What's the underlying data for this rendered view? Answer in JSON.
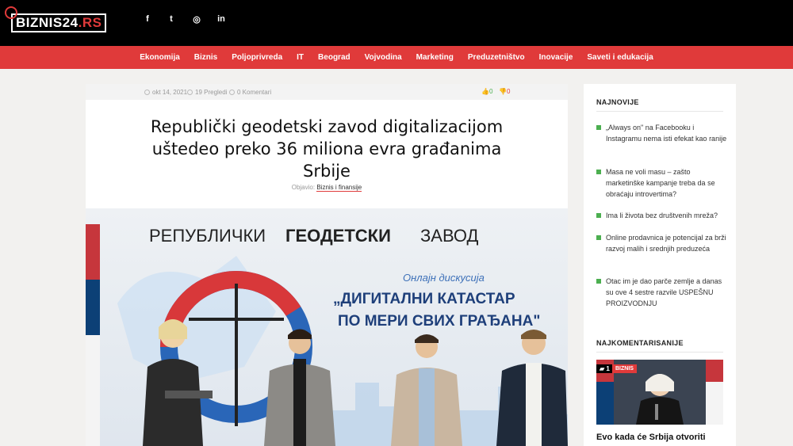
{
  "logo": {
    "main": "BIZNIS24",
    "accent": ".RS"
  },
  "social": [
    {
      "icon": "facebook-icon",
      "glyph": "f"
    },
    {
      "icon": "twitter-icon",
      "glyph": "t"
    },
    {
      "icon": "instagram-icon",
      "glyph": "◎"
    },
    {
      "icon": "linkedin-icon",
      "glyph": "in"
    }
  ],
  "nav": [
    "Ekonomija",
    "Biznis",
    "Poljoprivreda",
    "IT",
    "Beograd",
    "Vojvodina",
    "Marketing",
    "Preduzetništvo",
    "Inovacije",
    "Saveti i edukacija"
  ],
  "article": {
    "date": "okt 14, 2021",
    "views": "19 Pregledi",
    "comments": "0 Komentari",
    "likes": "0",
    "dislikes": "0",
    "title": "Republički geodetski zavod digitalizacijom uštedeo preko 36 miliona evra građanima Srbije",
    "byline_label": "Objavio:",
    "category": "Biznis i finansije",
    "hero": {
      "line1_a": "РЕПУБЛИЧКИ",
      "line1_b": "ГЕОДЕТСКИ",
      "line1_c": "ЗАВОД",
      "subtitle": "Онлајн дискусија",
      "line2": "„ДИГИТАЛНИ КАТАСТАР",
      "line3": "ПО МЕРИ СВИХ ГРАЂАНА\""
    }
  },
  "sidebar": {
    "latest_heading": "NAJNOVIJE",
    "latest": [
      "„Always on\" na Facebooku i Instagramu nema isti efekat kao ranije",
      "Masa ne voli masu – zašto marketinške kampanje treba da se obraćaju introvertima?",
      "Ima li života bez društvenih mreža?",
      "Online prodavnica je potencijal za brži razvoj malih i srednjih preduzeća",
      "Otac im je dao parče zemlje a danas su ove 4 sestre razvile USPEŠNU PROIZVODNJU"
    ],
    "commented_heading": "NAJKOMENTARISANIJE",
    "commented_count": "1",
    "commented_category": "BIZNIS",
    "commented_title": "Evo kada će Srbija otvoriti"
  },
  "colors": {
    "accent": "#e03a3a",
    "green": "#4caf50",
    "topbar": "#000000"
  }
}
